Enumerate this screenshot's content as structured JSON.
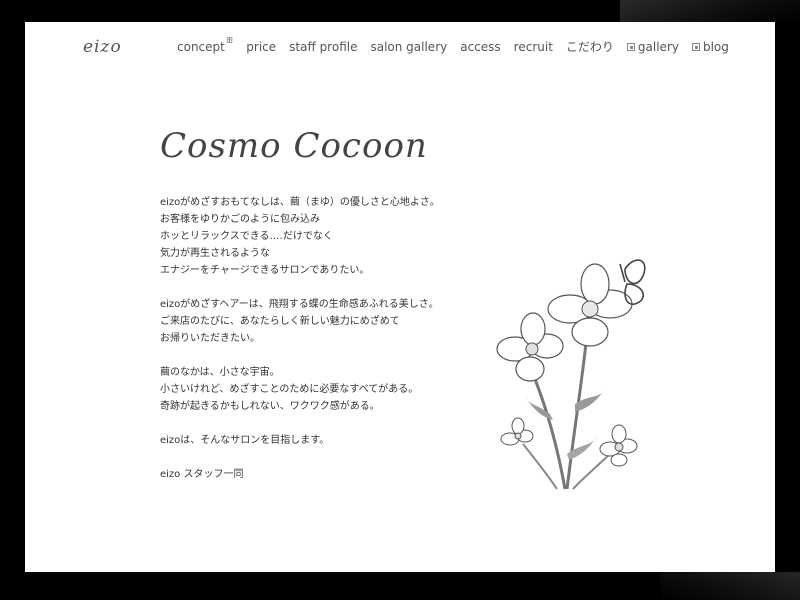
{
  "site": {
    "logo": "eizo"
  },
  "nav": {
    "items": [
      {
        "label": "concept",
        "glyph": "ꕥ"
      },
      {
        "label": "price"
      },
      {
        "label": "staff profile"
      },
      {
        "label": "salon gallery"
      },
      {
        "label": "access"
      },
      {
        "label": "recruit"
      },
      {
        "label": "こだわり"
      },
      {
        "label": "gallery",
        "external": true
      },
      {
        "label": "blog",
        "external": true
      }
    ]
  },
  "main": {
    "title": "Cosmo Cocoon",
    "paragraphs": [
      [
        "eizoがめざすおもてなしは、繭（まゆ）の優しさと心地よさ。",
        "お客様をゆりかごのように包み込み",
        "ホッとリラックスできる‥‥だけでなく",
        "気力が再生されるような",
        "エナジーをチャージできるサロンでありたい。"
      ],
      [
        "eizoがめざすヘアーは、飛翔する蝶の生命感あふれる美しさ。",
        "ご来店のたびに、あなたらしく新しい魅力にめざめて",
        "お帰りいただきたい。"
      ],
      [
        "繭のなかは、小さな宇宙。",
        "小さいけれど、めざすことのために必要なすべてがある。",
        "奇跡が起きるかもしれない、ワクワク感がある。"
      ],
      [
        "eizoは、そんなサロンを目指します。"
      ]
    ],
    "signature": "eizo スタッフ一同"
  },
  "colors": {
    "background": "#ffffff",
    "text": "#333333",
    "frame": "#000000"
  }
}
